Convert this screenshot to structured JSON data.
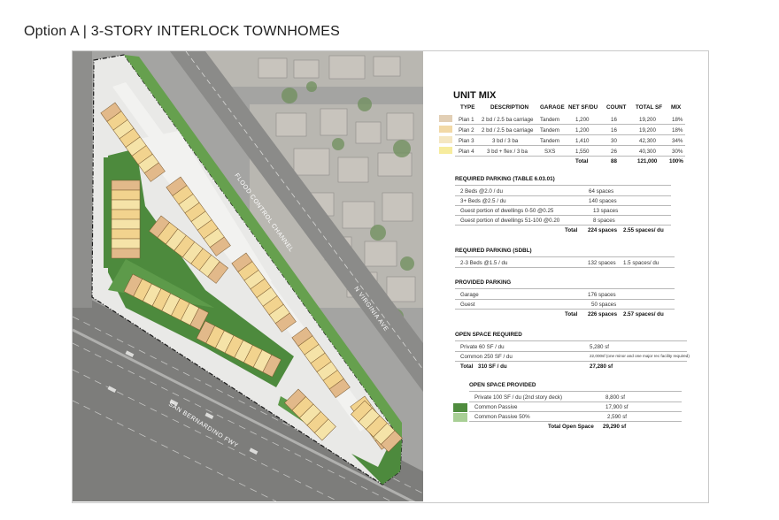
{
  "title": "Option A | 3-STORY INTERLOCK TOWNHOMES",
  "site_plan": {
    "streets": [
      "FLOOD CONTROL CHANNEL",
      "N VIRGINIA AVE",
      "SAN BERNARDINO FWY"
    ]
  },
  "unit_mix": {
    "title": "UNIT MIX",
    "headers": [
      "TYPE",
      "DESCRIPTION",
      "GARAGE",
      "NET SF/DU",
      "COUNT",
      "TOTAL SF",
      "MIX"
    ],
    "rows": [
      {
        "type": "Plan 1",
        "description": "2 bd / 2.5 ba carriage",
        "garage": "Tandem",
        "net_sf": "1,200",
        "count": "16",
        "total_sf": "19,200",
        "mix": "18%",
        "color": "#e2cfb5"
      },
      {
        "type": "Plan 2",
        "description": "2 bd / 2.5 ba carriage",
        "garage": "Tandem",
        "net_sf": "1,200",
        "count": "16",
        "total_sf": "19,200",
        "mix": "18%",
        "color": "#f2d9a6"
      },
      {
        "type": "Plan 3",
        "description": "3 bd / 3 ba",
        "garage": "Tandem",
        "net_sf": "1,410",
        "count": "30",
        "total_sf": "42,300",
        "mix": "34%",
        "color": "#f5e7c2"
      },
      {
        "type": "Plan 4",
        "description": "3 bd + flex / 3 ba",
        "garage": "SXS",
        "net_sf": "1,550",
        "count": "26",
        "total_sf": "40,300",
        "mix": "30%",
        "color": "#f7ec9e"
      }
    ],
    "total": {
      "label": "Total",
      "count": "88",
      "total_sf": "121,000",
      "mix": "100%"
    }
  },
  "required_parking": {
    "title": "REQUIRED PARKING (TABLE 6.03.01)",
    "rows": [
      {
        "label": "2 Beds @2.0 / du",
        "value": "64 spaces"
      },
      {
        "label": "3+ Beds @2.5 / du",
        "value": "140 spaces"
      },
      {
        "label": "Guest  portion of dwellings 0-50 @0.25",
        "value": "13 spaces"
      },
      {
        "label": "Guest  portion of dwellings 51-100 @0.20",
        "value": "8 spaces"
      }
    ],
    "total": {
      "label": "Total",
      "value": "224 spaces",
      "ratio": "2.55 spaces/ du"
    }
  },
  "sdbl_parking": {
    "title": "REQUIRED PARKING (SDBL)",
    "row": {
      "label": "2-3 Beds @1.5 / du",
      "value": "132 spaces",
      "ratio": "1.5 spaces/ du"
    }
  },
  "provided_parking": {
    "title": "PROVIDED PARKING",
    "rows": [
      {
        "label": "Garage",
        "value": "176 spaces"
      },
      {
        "label": "Guest",
        "value": "50 spaces"
      }
    ],
    "total": {
      "label": "Total",
      "value": "226 spaces",
      "ratio": "2.57 spaces/ du"
    }
  },
  "open_space_required": {
    "title": "OPEN SPACE REQUIRED",
    "rows": [
      {
        "label": "Private 60 SF / du",
        "value": "5,280 sf"
      },
      {
        "label": "Common 250 SF / du",
        "value": "22,000sf (one minor and one major rec facility required)"
      }
    ],
    "total": {
      "label": "Total",
      "per_du": "310 SF / du",
      "value": "27,280 sf"
    }
  },
  "open_space_provided": {
    "title": "OPEN SPACE PROVIDED",
    "rows": [
      {
        "label": "Private 100 SF / du  (2nd story deck)",
        "value": "8,800 sf",
        "color": ""
      },
      {
        "label": "Common Passive",
        "value": "17,900 sf",
        "color": "#4f8c3e"
      },
      {
        "label": "Common Passive 50%",
        "value": "2,590 sf",
        "color": "#a8cf95"
      }
    ],
    "total": {
      "label": "Total Open Space",
      "value": "29,290 sf"
    }
  }
}
